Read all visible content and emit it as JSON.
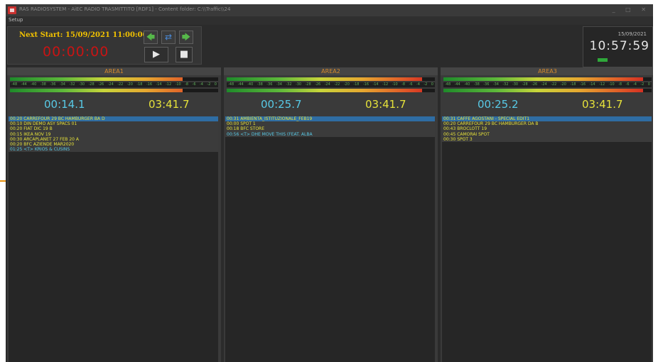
{
  "window": {
    "title": "RAS RADIOSYSTEM - AiEC RADIO TRASMITTITO [RDF1] - Content folder: C:\\\\Traffic\\\\24",
    "controls": "_ □ ✕"
  },
  "menu": {
    "setup": "Setup"
  },
  "control": {
    "next_start": "Next Start: 15/09/2021 11:00:00",
    "countdown": "00:00:00",
    "prev_icon": "🡄",
    "sync_icon": "⇄",
    "next_icon": "🡆",
    "play_icon": "▶",
    "stop_icon": "■"
  },
  "clock": {
    "date": "15/09/2021",
    "time": "10:57:59"
  },
  "vu_scale": [
    "-48",
    "-44",
    "-40",
    "-38",
    "-36",
    "-34",
    "-32",
    "-30",
    "-28",
    "-26",
    "-24",
    "-22",
    "-20",
    "-18",
    "-16",
    "-14",
    "-12",
    "-10",
    "-8",
    "-6",
    "-4",
    "-2",
    "0"
  ],
  "areas": [
    {
      "name": "AREA1",
      "vu_levels": [
        0.83,
        0.83
      ],
      "elapsed": "00:14.1",
      "total": "03:41.7",
      "items": [
        {
          "text": "00:20  CARREFOUR 29 BC HAMBURGER BA D",
          "selected": true,
          "blue": false
        },
        {
          "text": "00:10  DIN DEMO ASY SPACS 01",
          "selected": false,
          "blue": false
        },
        {
          "text": "00:20  FIAT DIC 19 B",
          "selected": false,
          "blue": false
        },
        {
          "text": "00:15  IKEA NOV 19",
          "selected": false,
          "blue": false
        },
        {
          "text": "00:30  ARCAPLANET 27 FEB 20 A",
          "selected": false,
          "blue": false
        },
        {
          "text": "00:20  BFC AZIENDE MAR2020",
          "selected": false,
          "blue": false
        },
        {
          "text": "01:25  <T> KRIOS & CUSINS",
          "selected": false,
          "blue": true
        }
      ]
    },
    {
      "name": "AREA2",
      "vu_levels": [
        0.94,
        0.94
      ],
      "elapsed": "00:25.7",
      "total": "03:41.7",
      "items": [
        {
          "text": "00:31  AMBIENTA_ISTITUZIONALE_FEB19",
          "selected": true,
          "blue": false
        },
        {
          "text": "00:00  SPOT 1",
          "selected": false,
          "blue": false
        },
        {
          "text": "00:18  BFC STORE",
          "selected": false,
          "blue": false
        },
        {
          "text": "00:56  <T> DHE MOVE THIS (FEAT. ALBA",
          "selected": false,
          "blue": true
        }
      ]
    },
    {
      "name": "AREA3",
      "vu_levels": [
        0.96,
        0.96
      ],
      "elapsed": "00:25.2",
      "total": "03:41.7",
      "items": [
        {
          "text": "00:31  CAFFE AGOSTANI - SPECIAL EDIT1",
          "selected": true,
          "blue": false
        },
        {
          "text": "00:20  CARREFOUR 29 BC HAMBURGER DA B",
          "selected": false,
          "blue": false
        },
        {
          "text": "00:43  BROCLOTT 19",
          "selected": false,
          "blue": false
        },
        {
          "text": "00:45  CAMORAI SPOT",
          "selected": false,
          "blue": false
        },
        {
          "text": "00:30  SPOT 3",
          "selected": false,
          "blue": false
        }
      ]
    }
  ]
}
